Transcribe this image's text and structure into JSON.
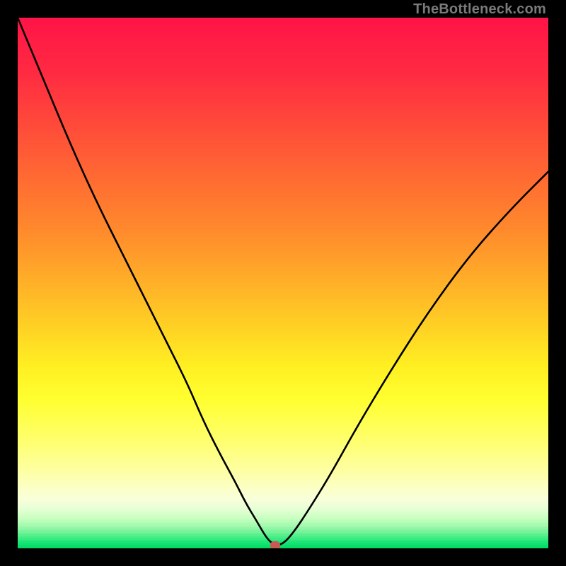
{
  "watermark": "TheBottleneck.com",
  "chart_data": {
    "type": "line",
    "title": "",
    "xlabel": "",
    "ylabel": "",
    "xlim": [
      0,
      100
    ],
    "ylim": [
      0,
      100
    ],
    "gradient_stops": [
      {
        "pos": 0.0,
        "color": "#ff1447"
      },
      {
        "pos": 0.1,
        "color": "#ff2a42"
      },
      {
        "pos": 0.2,
        "color": "#ff4a3a"
      },
      {
        "pos": 0.3,
        "color": "#ff6a32"
      },
      {
        "pos": 0.4,
        "color": "#ff8a2c"
      },
      {
        "pos": 0.5,
        "color": "#ffb028"
      },
      {
        "pos": 0.58,
        "color": "#ffd024"
      },
      {
        "pos": 0.66,
        "color": "#fff022"
      },
      {
        "pos": 0.72,
        "color": "#ffff30"
      },
      {
        "pos": 0.8,
        "color": "#ffff70"
      },
      {
        "pos": 0.86,
        "color": "#fdffa8"
      },
      {
        "pos": 0.905,
        "color": "#faffd8"
      },
      {
        "pos": 0.925,
        "color": "#e8ffd8"
      },
      {
        "pos": 0.945,
        "color": "#c8ffc0"
      },
      {
        "pos": 0.96,
        "color": "#a0f8ac"
      },
      {
        "pos": 0.975,
        "color": "#60f090"
      },
      {
        "pos": 0.988,
        "color": "#20e878"
      },
      {
        "pos": 1.0,
        "color": "#00d964"
      }
    ],
    "series": [
      {
        "name": "bottleneck-curve",
        "x": [
          0,
          5,
          10,
          15,
          20,
          24,
          28,
          32,
          35,
          38,
          41,
          43,
          45,
          46.5,
          47.5,
          48.5,
          50,
          52,
          55,
          59,
          64,
          70,
          77,
          85,
          93,
          100
        ],
        "y": [
          100,
          88,
          76,
          65,
          55,
          47,
          39,
          31,
          24,
          18,
          12.5,
          8.5,
          5.2,
          2.6,
          1.3,
          0.6,
          0.8,
          3.0,
          7.5,
          14,
          23,
          33,
          44,
          55,
          64,
          71
        ]
      }
    ],
    "marker": {
      "x": 48.5,
      "y": 0.6
    }
  }
}
